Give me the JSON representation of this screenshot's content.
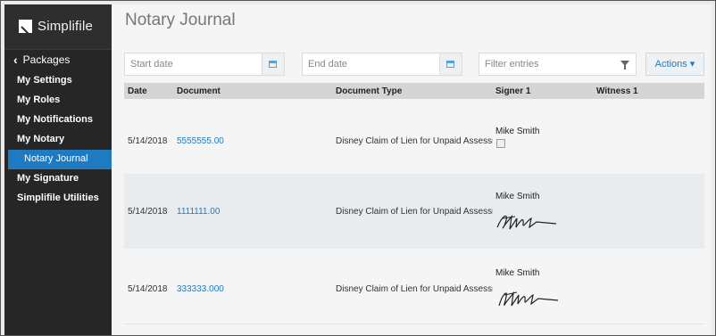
{
  "sidebar": {
    "logo_text": "Simplifile",
    "back_label": "Packages",
    "items": [
      {
        "label": "My Settings"
      },
      {
        "label": "My Roles"
      },
      {
        "label": "My Notifications"
      },
      {
        "label": "My Notary"
      },
      {
        "label": "Notary Journal",
        "active": true
      },
      {
        "label": "My Signature"
      },
      {
        "label": "Simplifile Utilities"
      }
    ]
  },
  "main": {
    "title": "Notary Journal",
    "filters": {
      "start_date_placeholder": "Start date",
      "end_date_placeholder": "End date",
      "filter_placeholder": "Filter entries",
      "actions_label": "Actions ▾"
    },
    "table": {
      "columns": [
        "Date",
        "Document",
        "Document Type",
        "Signer 1",
        "Witness 1"
      ],
      "rows": [
        {
          "date": "5/14/2018",
          "document": "5555555.00",
          "doc_type": "Disney Claim of Lien for Unpaid Assessme",
          "signer": "Mike Smith",
          "signature": "broken-image"
        },
        {
          "date": "5/14/2018",
          "document": "1111111.00",
          "doc_type": "Disney Claim of Lien for Unpaid Assessme",
          "signer": "Mike Smith",
          "signature": "handwritten"
        },
        {
          "date": "5/14/2018",
          "document": "333333.000",
          "doc_type": "Disney Claim of Lien for Unpaid Assessme",
          "signer": "Mike Smith",
          "signature": "handwritten"
        }
      ]
    }
  },
  "colors": {
    "sidebar_bg": "#262626",
    "accent": "#1f7ac0",
    "alt_row": "#e9ecee"
  }
}
